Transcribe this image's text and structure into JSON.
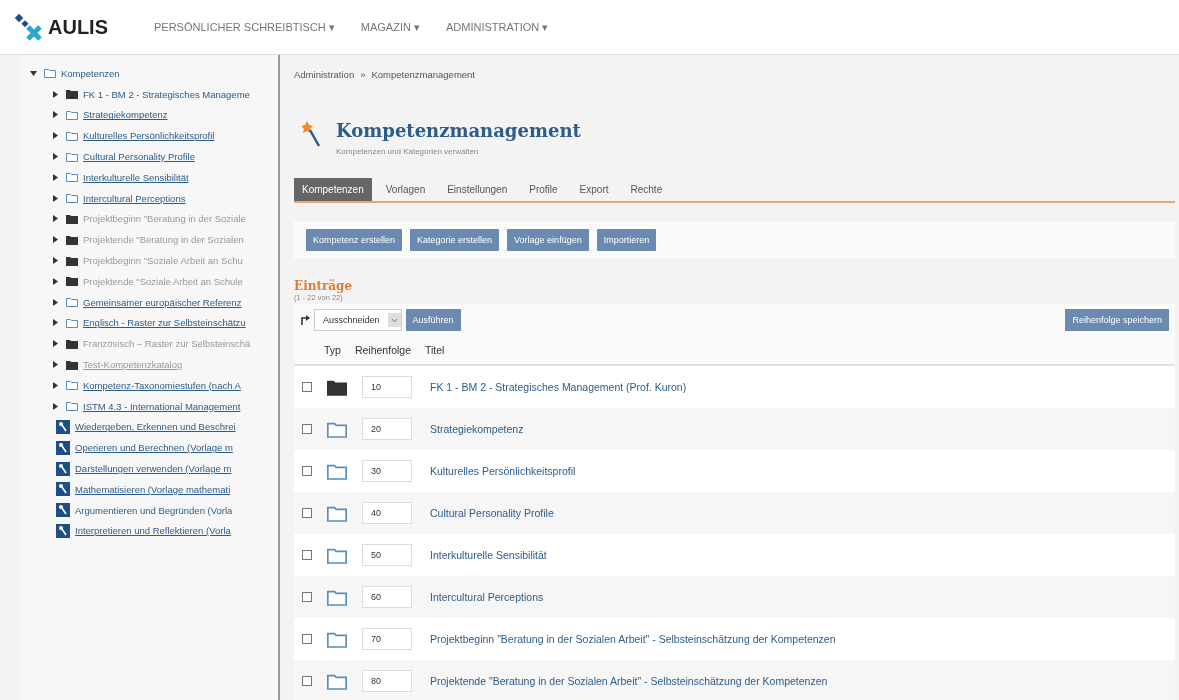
{
  "header": {
    "logo": "AULIS",
    "menu": [
      {
        "label": "PERSÖNLICHER SCHREIBTISCH",
        "caret": "▾"
      },
      {
        "label": "MAGAZIN",
        "caret": "▾"
      },
      {
        "label": "ADMINISTRATION",
        "caret": "▾"
      }
    ]
  },
  "tree": {
    "label": "Kompetenzen",
    "kind": "folder",
    "expanded": true,
    "children": [
      {
        "label": "FK 1 - BM 2 - Strategisches Manageme",
        "kind": "category",
        "linked": false,
        "muted": false
      },
      {
        "label": "Strategiekompetenz",
        "kind": "folder",
        "linked": true,
        "muted": false
      },
      {
        "label": "Kulturelles Persönlichkeitsprofil",
        "kind": "folder",
        "linked": true,
        "muted": false
      },
      {
        "label": "Cultural Personality Profile",
        "kind": "folder",
        "linked": true,
        "muted": false
      },
      {
        "label": "Interkulturelle Sensibilität",
        "kind": "folder",
        "linked": true,
        "muted": false
      },
      {
        "label": "Intercultural Perceptions",
        "kind": "folder",
        "linked": true,
        "muted": false
      },
      {
        "label": "Projektbeginn \"Beratung in der Soziale",
        "kind": "category",
        "linked": false,
        "muted": true
      },
      {
        "label": "Projektende \"Beratung in der Sozialen",
        "kind": "category",
        "linked": false,
        "muted": true
      },
      {
        "label": "Projektbeginn \"Soziale Arbeit an Schu",
        "kind": "category",
        "linked": false,
        "muted": true
      },
      {
        "label": "Projektende \"Soziale Arbeit an Schule",
        "kind": "category",
        "linked": false,
        "muted": true
      },
      {
        "label": "Gemeinsamer europäischer Referenz",
        "kind": "folder",
        "linked": true,
        "muted": false
      },
      {
        "label": "Englisch - Raster zur Selbsteinschätzu",
        "kind": "folder",
        "linked": true,
        "muted": false
      },
      {
        "label": "Französisch – Raster zur Selbsteinschä",
        "kind": "category",
        "linked": false,
        "muted": true
      },
      {
        "label": "Test-Kompetenzkatalog",
        "kind": "category",
        "linked": true,
        "muted": true
      },
      {
        "label": "Kompetenz-Taxonomiestufen (nach A",
        "kind": "folder",
        "linked": true,
        "muted": false
      },
      {
        "label": "ISTM 4.3 - International Management",
        "kind": "folder",
        "linked": true,
        "muted": false
      },
      {
        "label": "Wiedergeben, Erkennen und Beschrei",
        "kind": "competence",
        "linked": true,
        "muted": false
      },
      {
        "label": "Operieren und Berechnen (Vorlage m",
        "kind": "competence",
        "linked": true,
        "muted": false
      },
      {
        "label": "Darstellungen verwenden (Vorlage m",
        "kind": "competence",
        "linked": true,
        "muted": false
      },
      {
        "label": "Mathematisieren (Vorlage mathemati",
        "kind": "competence",
        "linked": true,
        "muted": false
      },
      {
        "label": "Argumentieren und Begründen (Vorla",
        "kind": "competence",
        "linked": false,
        "muted": false
      },
      {
        "label": "Interpretieren und Reflektieren (Vorla",
        "kind": "competence",
        "linked": true,
        "muted": false
      }
    ]
  },
  "breadcrumb": [
    {
      "label": "Administration"
    },
    {
      "label": "Kompetenzmanagement"
    }
  ],
  "breadcrumb_separator": "»",
  "page": {
    "title": "Kompetenzmanagement",
    "subtitle": "Kompetenzen und Kategorien verwalten"
  },
  "tabs": [
    {
      "label": "Kompetenzen",
      "selected": true
    },
    {
      "label": "Vorlagen",
      "selected": false
    },
    {
      "label": "Einstellungen",
      "selected": false
    },
    {
      "label": "Profile",
      "selected": false
    },
    {
      "label": "Export",
      "selected": false
    },
    {
      "label": "Rechte",
      "selected": false
    }
  ],
  "toolbar": [
    "Kompetenz erstellen",
    "Kategorie erstellen",
    "Vorlage einfügen",
    "Importieren"
  ],
  "list": {
    "title": "Einträge",
    "count": "(1 - 22 von 22)",
    "action_select": "Ausschneiden",
    "action_button": "Ausführen",
    "save_button": "Reihenfolge speichern",
    "columns": [
      "Typ",
      "Reihenfolge",
      "Titel"
    ],
    "rows": [
      {
        "kind": "category",
        "order": "10",
        "title": "FK 1 - BM 2 - Strategisches Management (Prof. Kuron)",
        "checked": false
      },
      {
        "kind": "folder",
        "order": "20",
        "title": "Strategiekompetenz",
        "checked": false
      },
      {
        "kind": "folder",
        "order": "30",
        "title": "Kulturelles Persönlichkeitsprofil",
        "checked": false
      },
      {
        "kind": "folder",
        "order": "40",
        "title": "Cultural Personality Profile",
        "checked": false
      },
      {
        "kind": "folder",
        "order": "50",
        "title": "Interkulturelle Sensibilität",
        "checked": false
      },
      {
        "kind": "folder",
        "order": "60",
        "title": "Intercultural Perceptions",
        "checked": false
      },
      {
        "kind": "folder",
        "order": "70",
        "title": "Projektbeginn \"Beratung in der Sozialen Arbeit\" - Selbsteinschätzung der Kompetenzen",
        "checked": false
      },
      {
        "kind": "folder",
        "order": "80",
        "title": "Projektende \"Beratung in der Sozialen Arbeit\" - Selbsteinschätzung der Kompetenzen",
        "checked": false
      }
    ]
  }
}
